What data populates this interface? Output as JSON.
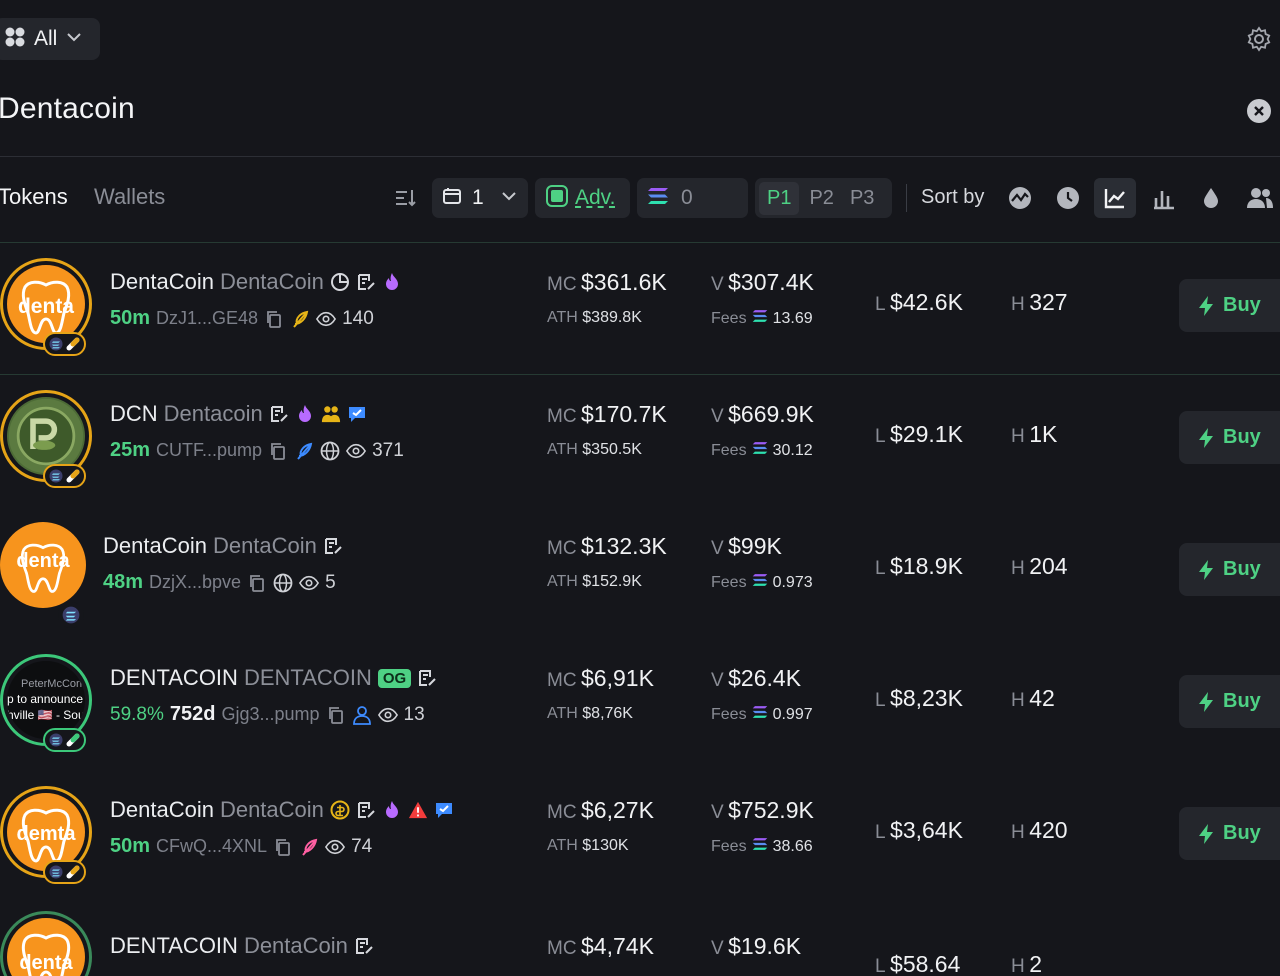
{
  "topbar": {
    "chain_filter": "All"
  },
  "search": {
    "query": "Dentacoin"
  },
  "tabs": [
    {
      "label": "Tokens"
    },
    {
      "label": "Wallets"
    }
  ],
  "controls": {
    "folder_value": "1",
    "adv_label": "Adv.",
    "sol_value": "0",
    "presets": [
      "P1",
      "P2",
      "P3"
    ],
    "sort_label": "Sort by"
  },
  "colors": {
    "accent_green": "#4ed184",
    "background": "#15161b",
    "surface": "#24262c"
  },
  "rows": [
    {
      "name": "DentaCoin",
      "ticker": "DentaCoin",
      "age": "50m",
      "percent": "",
      "address": "DzJ1...GE48",
      "viewers": "140",
      "mc": "$361.6K",
      "ath": "$389.8K",
      "volume": "$307.4K",
      "fees": "13.69",
      "liquidity": "$42.6K",
      "holders": "327",
      "avatar_text": "denta"
    },
    {
      "name": "DCN",
      "ticker": "Dentacoin",
      "age": "25m",
      "percent": "",
      "address": "CUTF...pump",
      "viewers": "371",
      "mc": "$170.7K",
      "ath": "$350.5K",
      "volume": "$669.9K",
      "fees": "30.12",
      "liquidity": "$29.1K",
      "holders": "1K",
      "avatar_text": "P"
    },
    {
      "name": "DentaCoin",
      "ticker": "DentaCoin",
      "age": "48m",
      "percent": "",
      "address": "DzjX...bpve",
      "viewers": "5",
      "mc": "$132.3K",
      "ath": "$152.9K",
      "volume": "$99K",
      "fees": "0.973",
      "liquidity": "$18.9K",
      "holders": "204",
      "avatar_text": "denta"
    },
    {
      "name": "DENTACOIN",
      "ticker": "DENTACOIN",
      "age": "752d",
      "percent": "59.8%",
      "address": "Gjg3...pump",
      "viewers": "13",
      "mc": "$6,91K",
      "ath": "$8,76K",
      "volume": "$26.4K",
      "fees": "0.997",
      "liquidity": "$8,23K",
      "holders": "42",
      "badge": "OG",
      "avatar_lines": [
        "PeterMcCorm",
        "p to announce",
        "hville 🇺🇸 - Sou"
      ]
    },
    {
      "name": "DentaCoin",
      "ticker": "DentaCoin",
      "age": "50m",
      "percent": "",
      "address": "CFwQ...4XNL",
      "viewers": "74",
      "mc": "$6,27K",
      "ath": "$130K",
      "volume": "$752.9K",
      "fees": "38.66",
      "liquidity": "$3,64K",
      "holders": "420",
      "avatar_text": "demta"
    },
    {
      "name": "DENTACOIN",
      "ticker": "DentaCoin",
      "age": "",
      "percent": "",
      "address": "",
      "viewers": "",
      "mc": "$4,74K",
      "ath": "",
      "volume": "$19.6K",
      "fees": "",
      "liquidity": "$58.64",
      "holders": "2",
      "avatar_text": "denta"
    }
  ],
  "labels": {
    "mc": "MC",
    "ath": "ATH",
    "v": "V",
    "fees": "Fees",
    "l": "L",
    "h": "H",
    "buy": "Buy"
  }
}
